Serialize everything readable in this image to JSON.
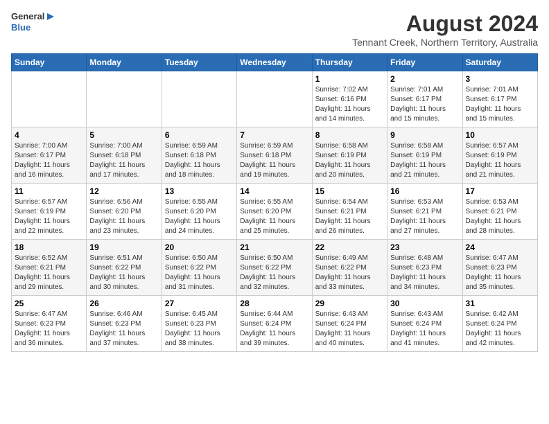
{
  "logo": {
    "general": "General",
    "blue": "Blue"
  },
  "title": "August 2024",
  "subtitle": "Tennant Creek, Northern Territory, Australia",
  "header_days": [
    "Sunday",
    "Monday",
    "Tuesday",
    "Wednesday",
    "Thursday",
    "Friday",
    "Saturday"
  ],
  "weeks": [
    [
      {
        "day": "",
        "info": ""
      },
      {
        "day": "",
        "info": ""
      },
      {
        "day": "",
        "info": ""
      },
      {
        "day": "",
        "info": ""
      },
      {
        "day": "1",
        "info": "Sunrise: 7:02 AM\nSunset: 6:16 PM\nDaylight: 11 hours\nand 14 minutes."
      },
      {
        "day": "2",
        "info": "Sunrise: 7:01 AM\nSunset: 6:17 PM\nDaylight: 11 hours\nand 15 minutes."
      },
      {
        "day": "3",
        "info": "Sunrise: 7:01 AM\nSunset: 6:17 PM\nDaylight: 11 hours\nand 15 minutes."
      }
    ],
    [
      {
        "day": "4",
        "info": "Sunrise: 7:00 AM\nSunset: 6:17 PM\nDaylight: 11 hours\nand 16 minutes."
      },
      {
        "day": "5",
        "info": "Sunrise: 7:00 AM\nSunset: 6:18 PM\nDaylight: 11 hours\nand 17 minutes."
      },
      {
        "day": "6",
        "info": "Sunrise: 6:59 AM\nSunset: 6:18 PM\nDaylight: 11 hours\nand 18 minutes."
      },
      {
        "day": "7",
        "info": "Sunrise: 6:59 AM\nSunset: 6:18 PM\nDaylight: 11 hours\nand 19 minutes."
      },
      {
        "day": "8",
        "info": "Sunrise: 6:58 AM\nSunset: 6:19 PM\nDaylight: 11 hours\nand 20 minutes."
      },
      {
        "day": "9",
        "info": "Sunrise: 6:58 AM\nSunset: 6:19 PM\nDaylight: 11 hours\nand 21 minutes."
      },
      {
        "day": "10",
        "info": "Sunrise: 6:57 AM\nSunset: 6:19 PM\nDaylight: 11 hours\nand 21 minutes."
      }
    ],
    [
      {
        "day": "11",
        "info": "Sunrise: 6:57 AM\nSunset: 6:19 PM\nDaylight: 11 hours\nand 22 minutes."
      },
      {
        "day": "12",
        "info": "Sunrise: 6:56 AM\nSunset: 6:20 PM\nDaylight: 11 hours\nand 23 minutes."
      },
      {
        "day": "13",
        "info": "Sunrise: 6:55 AM\nSunset: 6:20 PM\nDaylight: 11 hours\nand 24 minutes."
      },
      {
        "day": "14",
        "info": "Sunrise: 6:55 AM\nSunset: 6:20 PM\nDaylight: 11 hours\nand 25 minutes."
      },
      {
        "day": "15",
        "info": "Sunrise: 6:54 AM\nSunset: 6:21 PM\nDaylight: 11 hours\nand 26 minutes."
      },
      {
        "day": "16",
        "info": "Sunrise: 6:53 AM\nSunset: 6:21 PM\nDaylight: 11 hours\nand 27 minutes."
      },
      {
        "day": "17",
        "info": "Sunrise: 6:53 AM\nSunset: 6:21 PM\nDaylight: 11 hours\nand 28 minutes."
      }
    ],
    [
      {
        "day": "18",
        "info": "Sunrise: 6:52 AM\nSunset: 6:21 PM\nDaylight: 11 hours\nand 29 minutes."
      },
      {
        "day": "19",
        "info": "Sunrise: 6:51 AM\nSunset: 6:22 PM\nDaylight: 11 hours\nand 30 minutes."
      },
      {
        "day": "20",
        "info": "Sunrise: 6:50 AM\nSunset: 6:22 PM\nDaylight: 11 hours\nand 31 minutes."
      },
      {
        "day": "21",
        "info": "Sunrise: 6:50 AM\nSunset: 6:22 PM\nDaylight: 11 hours\nand 32 minutes."
      },
      {
        "day": "22",
        "info": "Sunrise: 6:49 AM\nSunset: 6:22 PM\nDaylight: 11 hours\nand 33 minutes."
      },
      {
        "day": "23",
        "info": "Sunrise: 6:48 AM\nSunset: 6:23 PM\nDaylight: 11 hours\nand 34 minutes."
      },
      {
        "day": "24",
        "info": "Sunrise: 6:47 AM\nSunset: 6:23 PM\nDaylight: 11 hours\nand 35 minutes."
      }
    ],
    [
      {
        "day": "25",
        "info": "Sunrise: 6:47 AM\nSunset: 6:23 PM\nDaylight: 11 hours\nand 36 minutes."
      },
      {
        "day": "26",
        "info": "Sunrise: 6:46 AM\nSunset: 6:23 PM\nDaylight: 11 hours\nand 37 minutes."
      },
      {
        "day": "27",
        "info": "Sunrise: 6:45 AM\nSunset: 6:23 PM\nDaylight: 11 hours\nand 38 minutes."
      },
      {
        "day": "28",
        "info": "Sunrise: 6:44 AM\nSunset: 6:24 PM\nDaylight: 11 hours\nand 39 minutes."
      },
      {
        "day": "29",
        "info": "Sunrise: 6:43 AM\nSunset: 6:24 PM\nDaylight: 11 hours\nand 40 minutes."
      },
      {
        "day": "30",
        "info": "Sunrise: 6:43 AM\nSunset: 6:24 PM\nDaylight: 11 hours\nand 41 minutes."
      },
      {
        "day": "31",
        "info": "Sunrise: 6:42 AM\nSunset: 6:24 PM\nDaylight: 11 hours\nand 42 minutes."
      }
    ]
  ]
}
